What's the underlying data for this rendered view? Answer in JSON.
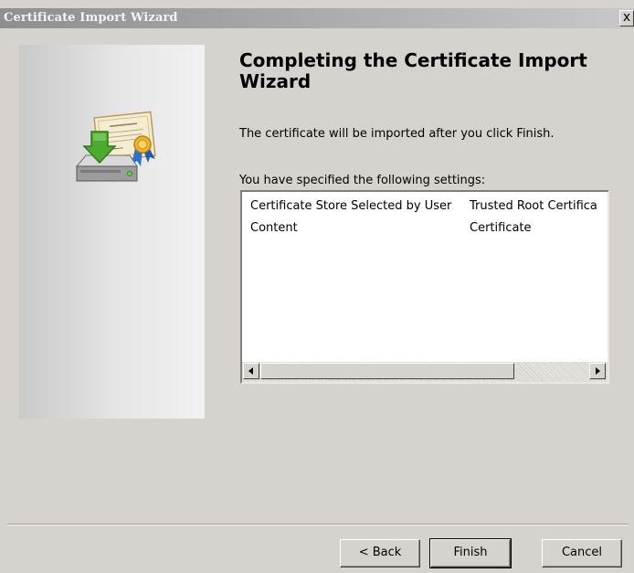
{
  "window": {
    "title": "Certificate Import Wizard",
    "close_label": "x"
  },
  "main": {
    "heading": "Completing the Certificate Import Wizard",
    "info": "The certificate will be imported after you click Finish.",
    "settings_label": "You have specified the following settings:",
    "settings": [
      {
        "name": "Certificate Store Selected by User",
        "value": "Trusted Root Certifica"
      },
      {
        "name": "Content",
        "value": "Certificate"
      }
    ]
  },
  "buttons": {
    "back": "< Back",
    "finish": "Finish",
    "cancel": "Cancel"
  },
  "icons": {
    "wizard_icon": "certificate-import-icon",
    "scroll_left": "left-arrow-icon",
    "scroll_right": "right-arrow-icon"
  }
}
